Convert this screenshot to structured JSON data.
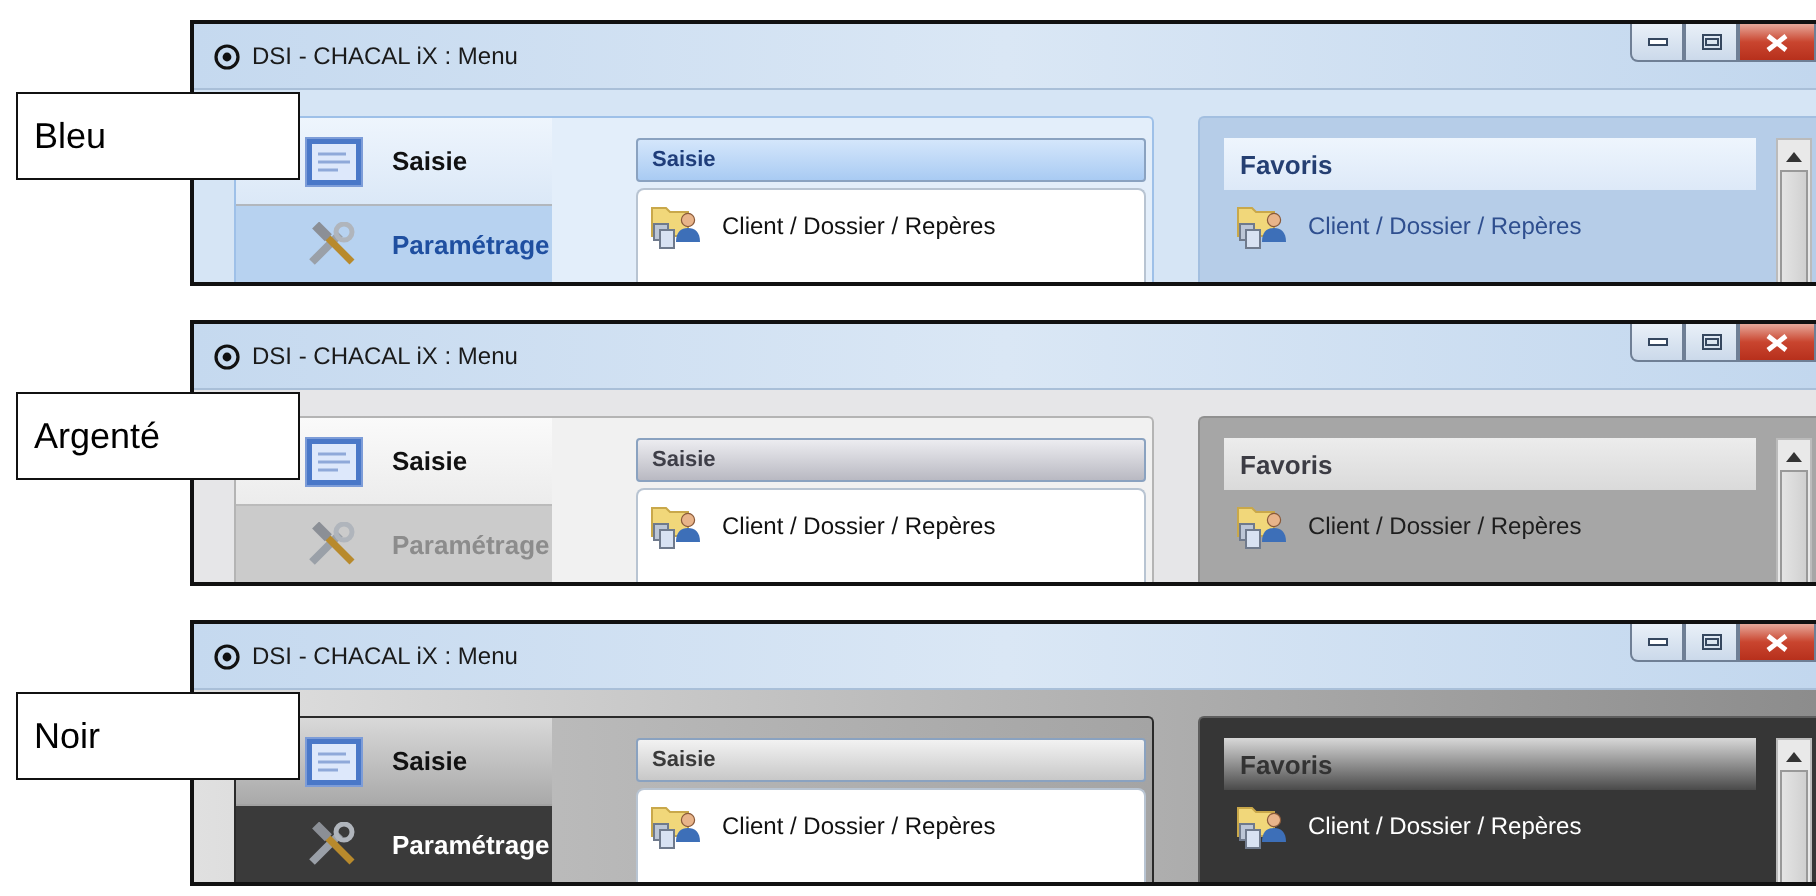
{
  "variants": [
    {
      "label": "Bleu",
      "kind": "bleu",
      "window": {
        "title": "DSI - CHACAL iX : Menu"
      },
      "nav": [
        {
          "label": "Saisie",
          "selected": true
        },
        {
          "label": "Paramétrage",
          "selected": false
        }
      ],
      "panel": {
        "header": "Saisie",
        "items": [
          "Client / Dossier / Repères"
        ]
      },
      "favorites": {
        "header": "Favoris",
        "items": [
          "Client / Dossier / Repères"
        ]
      }
    },
    {
      "label": "Argenté",
      "kind": "argente",
      "window": {
        "title": "DSI - CHACAL iX : Menu"
      },
      "nav": [
        {
          "label": "Saisie",
          "selected": true
        },
        {
          "label": "Paramétrage",
          "selected": false
        }
      ],
      "panel": {
        "header": "Saisie",
        "items": [
          "Client / Dossier / Repères"
        ]
      },
      "favorites": {
        "header": "Favoris",
        "items": [
          "Client / Dossier / Repères"
        ]
      }
    },
    {
      "label": "Noir",
      "kind": "noir",
      "window": {
        "title": "DSI - CHACAL iX : Menu"
      },
      "nav": [
        {
          "label": "Saisie",
          "selected": true
        },
        {
          "label": "Paramétrage",
          "selected": false
        }
      ],
      "panel": {
        "header": "Saisie",
        "items": [
          "Client / Dossier / Repères"
        ]
      },
      "favorites": {
        "header": "Favoris",
        "items": [
          "Client / Dossier / Repères"
        ]
      }
    }
  ]
}
